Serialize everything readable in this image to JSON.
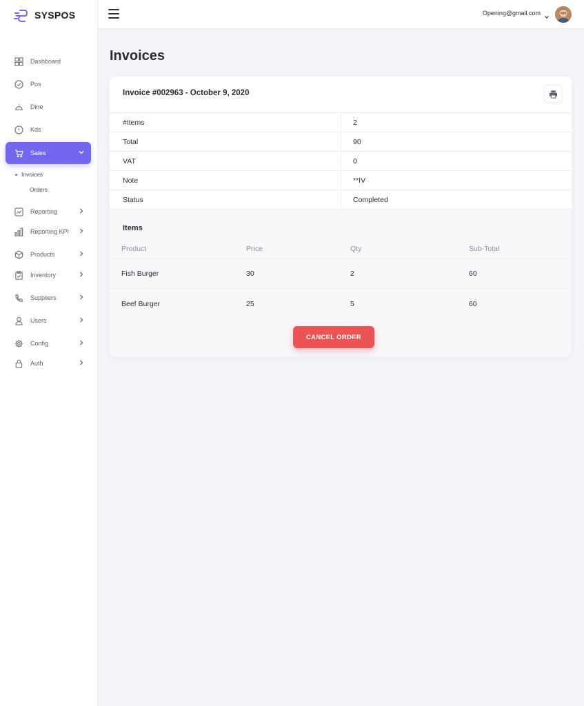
{
  "brand": {
    "name": "SYSPOS",
    "accent": "#7367f0"
  },
  "sidebar": {
    "items": [
      {
        "label": "Dashboard",
        "icon": "grid-icon"
      },
      {
        "label": "Pos",
        "icon": "check-circle-icon"
      },
      {
        "label": "Dine",
        "icon": "cloche-icon"
      },
      {
        "label": "Kds",
        "icon": "alert-circle-icon"
      },
      {
        "label": "Sales",
        "icon": "cart-icon",
        "active": true,
        "expanded": true
      },
      {
        "label": "Reporting",
        "icon": "trending-chart-icon"
      },
      {
        "label": "Reporting KPI",
        "icon": "bar-chart-icon"
      },
      {
        "label": "Products",
        "icon": "box-icon"
      },
      {
        "label": "Inventory",
        "icon": "clipboard-icon"
      },
      {
        "label": "Suppliers",
        "icon": "phone-icon"
      },
      {
        "label": "Users",
        "icon": "user-icon"
      },
      {
        "label": "Config",
        "icon": "settings-icon"
      },
      {
        "label": "Auth",
        "icon": "lock-icon"
      }
    ],
    "sales_sub": [
      {
        "label": "Invoices",
        "active": true
      },
      {
        "label": "Orders"
      }
    ]
  },
  "topbar": {
    "email": "Opening@gmail.com"
  },
  "page": {
    "title": "Invoices"
  },
  "invoice": {
    "title": "Invoice #002963 - October 9, 2020",
    "details": [
      {
        "key": "#Items",
        "value": "2"
      },
      {
        "key": "Total",
        "value": "90"
      },
      {
        "key": "VAT",
        "value": "0"
      },
      {
        "key": "Note",
        "value": "**IV"
      },
      {
        "key": "Status",
        "value": "Completed"
      }
    ],
    "items_title": "Items",
    "columns": [
      "Product",
      "Price",
      "Qty",
      "Sub-Total"
    ],
    "rows": [
      [
        "Fish Burger",
        "30",
        "2",
        "60"
      ],
      [
        "Beef Burger",
        "25",
        "5",
        "60"
      ]
    ],
    "cancel_label": "CANCEL ORDER"
  },
  "colors": {
    "danger": "#ea5455"
  }
}
